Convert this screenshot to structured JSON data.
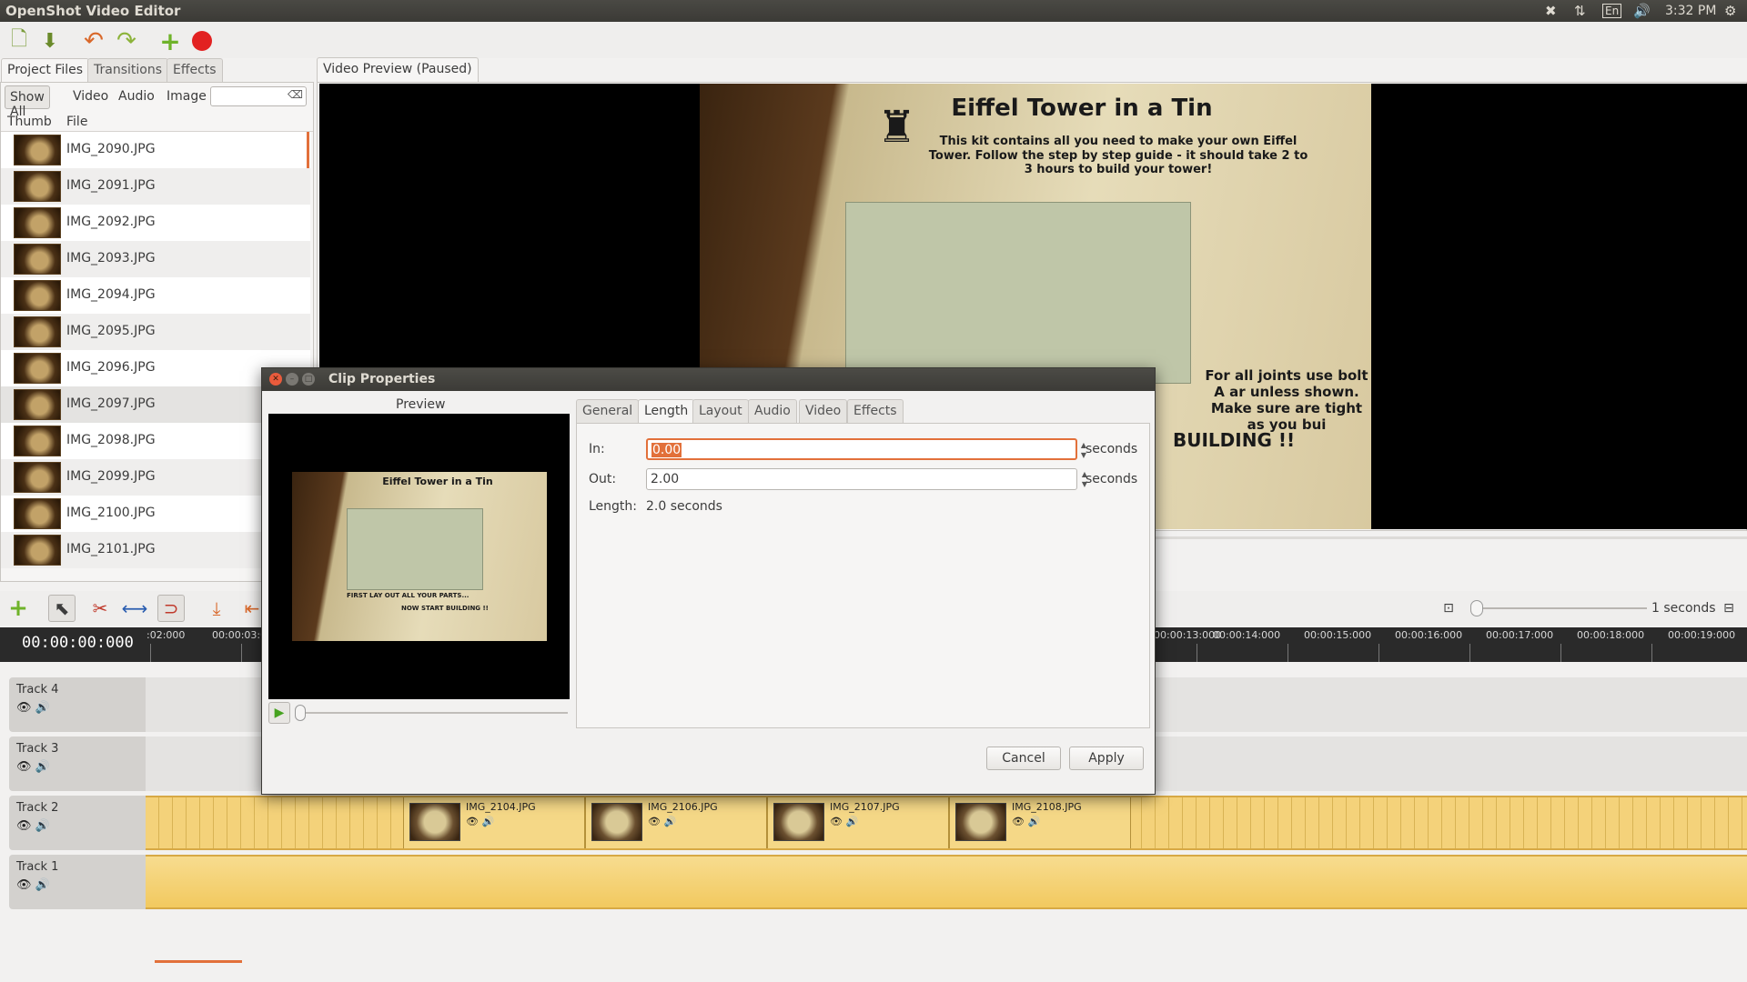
{
  "system": {
    "app_title": "OpenShot Video Editor",
    "keyboard": "En",
    "clock": "3:32 PM"
  },
  "toolbar": {
    "icons": [
      "new-project-icon",
      "save-project-icon",
      "undo-icon",
      "redo-icon",
      "import-files-icon",
      "export-video-icon"
    ]
  },
  "left_tabs": [
    "Project Files",
    "Transitions",
    "Effects"
  ],
  "filters": {
    "buttons": [
      "Show All",
      "Video",
      "Audio",
      "Image"
    ],
    "search_value": ""
  },
  "file_list": {
    "headers": {
      "thumb": "Thumb",
      "file": "File"
    },
    "files": [
      "IMG_2090.JPG",
      "IMG_2091.JPG",
      "IMG_2092.JPG",
      "IMG_2093.JPG",
      "IMG_2094.JPG",
      "IMG_2095.JPG",
      "IMG_2096.JPG",
      "IMG_2097.JPG",
      "IMG_2098.JPG",
      "IMG_2099.JPG",
      "IMG_2100.JPG",
      "IMG_2101.JPG"
    ]
  },
  "preview": {
    "tab_label": "Video Preview (Paused)",
    "poster_title": "Eiffel Tower in a Tin",
    "poster_intro": "This kit contains all you need to make your own Eiffel Tower. Follow the step by step guide - it should take 2 to 3 hours to build your tower!",
    "poster_side": "For all joints use bolt A ar unless shown. Make sure are tight as you bui",
    "poster_building": "BUILDING !!",
    "poster_first": "FIRST LAY OUT ALL YOUR PARTS...",
    "poster_now": "NOW START BUILDING !!"
  },
  "timeline": {
    "timecode": "00:00:00:000",
    "zoom_label": "1 seconds",
    "ticks": [
      ":02:000",
      "00:00:03:00",
      "00:00:13:000",
      "00:00:14:000",
      "00:00:15:000",
      "00:00:16:000",
      "00:00:17:000",
      "00:00:18:000",
      "00:00:19:000"
    ],
    "tracks": [
      {
        "name": "Track 4"
      },
      {
        "name": "Track 3"
      },
      {
        "name": "Track 2"
      },
      {
        "name": "Track 1"
      }
    ],
    "clips": [
      "IMG_2104.JPG",
      "IMG_2106.JPG",
      "IMG_2107.JPG",
      "IMG_2108.JPG"
    ]
  },
  "dialog": {
    "title": "Clip Properties",
    "preview_label": "Preview",
    "tabs": [
      "General",
      "Length",
      "Layout",
      "Audio",
      "Video",
      "Effects"
    ],
    "active_tab": "Length",
    "in_label": "In:",
    "in_value": "0.00",
    "out_label": "Out:",
    "out_value": "2.00",
    "unit": "seconds",
    "length_label": "Length:",
    "length_value": "2.0 seconds",
    "cancel": "Cancel",
    "apply": "Apply"
  },
  "colors": {
    "accent": "#e2703a",
    "clip": "#f4d27a",
    "panel": "#3b3a36"
  }
}
